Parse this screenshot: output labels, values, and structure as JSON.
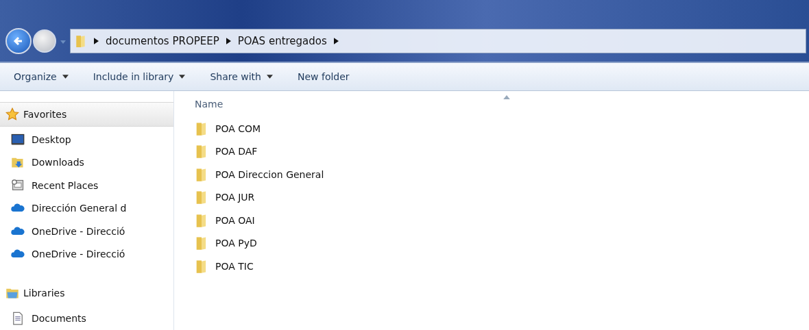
{
  "address_bar": {
    "crumbs": [
      "documentos PROPEEP",
      "POAS entregados"
    ]
  },
  "toolbar": {
    "buttons": [
      {
        "label": "Organize",
        "dropdown": true
      },
      {
        "label": "Include in library",
        "dropdown": true
      },
      {
        "label": "Share with",
        "dropdown": true
      },
      {
        "label": "New folder",
        "dropdown": false
      }
    ]
  },
  "sidebar": {
    "groups": [
      {
        "label": "Favorites",
        "kind": "star",
        "selected": true,
        "children": [
          {
            "label": "Desktop",
            "kind": "desktop"
          },
          {
            "label": "Downloads",
            "kind": "downloads"
          },
          {
            "label": "Recent Places",
            "kind": "recent"
          },
          {
            "label": "Dirección General d",
            "kind": "cloud"
          },
          {
            "label": "OneDrive - Direcció",
            "kind": "cloud"
          },
          {
            "label": "OneDrive - Direcció",
            "kind": "cloud"
          }
        ]
      },
      {
        "label": "Libraries",
        "kind": "libraries",
        "selected": false,
        "children": [
          {
            "label": "Documents",
            "kind": "document"
          }
        ]
      }
    ]
  },
  "file_list": {
    "column": "Name",
    "items": [
      {
        "name": "POA COM"
      },
      {
        "name": "POA DAF"
      },
      {
        "name": "POA Direccion General"
      },
      {
        "name": "POA JUR"
      },
      {
        "name": "POA OAI"
      },
      {
        "name": "POA PyD"
      },
      {
        "name": "POA TIC"
      }
    ]
  }
}
